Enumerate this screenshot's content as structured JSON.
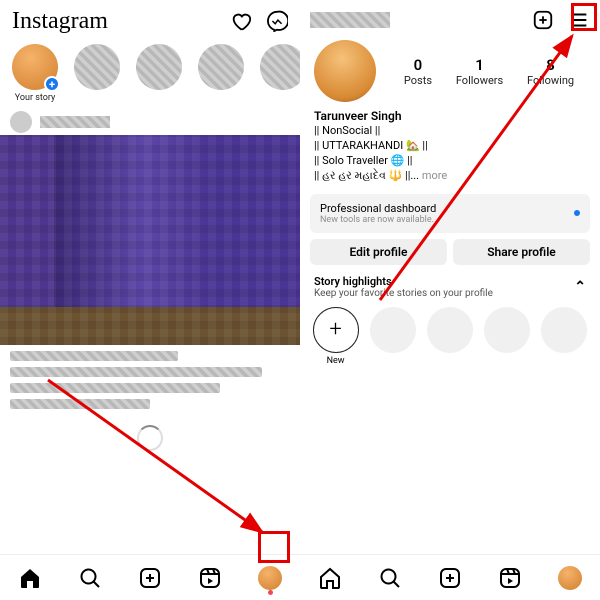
{
  "feed": {
    "logo": "Instagram",
    "your_story_label": "Your story",
    "nav": [
      "home",
      "search",
      "create",
      "reels",
      "profile"
    ]
  },
  "profile": {
    "stats": {
      "posts_count": "0",
      "posts_label": "Posts",
      "followers_count": "1",
      "followers_label": "Followers",
      "following_count": "8",
      "following_label": "Following"
    },
    "name": "Tarunveer Singh",
    "bio_lines": [
      "|| NonSocial ||",
      "|| UTTARAKHANDI 🏡 ||",
      "|| Solo Traveller 🌐 ||",
      "|| હર હર મહાદેવ 🔱 ||..."
    ],
    "bio_more": " more",
    "dashboard_title": "Professional dashboard",
    "dashboard_sub": "New tools are now available.",
    "edit_btn": "Edit profile",
    "share_btn": "Share profile",
    "highlights_title": "Story highlights",
    "highlights_sub": "Keep your favorite stories on your profile",
    "highlight_new_label": "New"
  }
}
